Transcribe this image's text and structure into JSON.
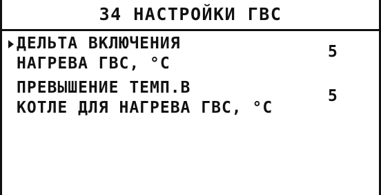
{
  "header": {
    "title": "34 НАСТРОЙКИ ГВС"
  },
  "menu": {
    "items": [
      {
        "line1": "ДЕЛЬТА ВКЛЮЧЕНИЯ",
        "line2": "НАГРЕВА ГВС, °C",
        "value": "5",
        "selected": true
      },
      {
        "line1": "ПРЕВЫШЕНИЕ ТЕМП.В",
        "line2": "КОТЛЕ ДЛЯ НАГРЕВА ГВС, °C",
        "value": "5",
        "selected": false
      }
    ]
  },
  "icons": {
    "cursor": "triangle-right-icon"
  },
  "colors": {
    "background": "#ffffff",
    "foreground": "#111111"
  }
}
